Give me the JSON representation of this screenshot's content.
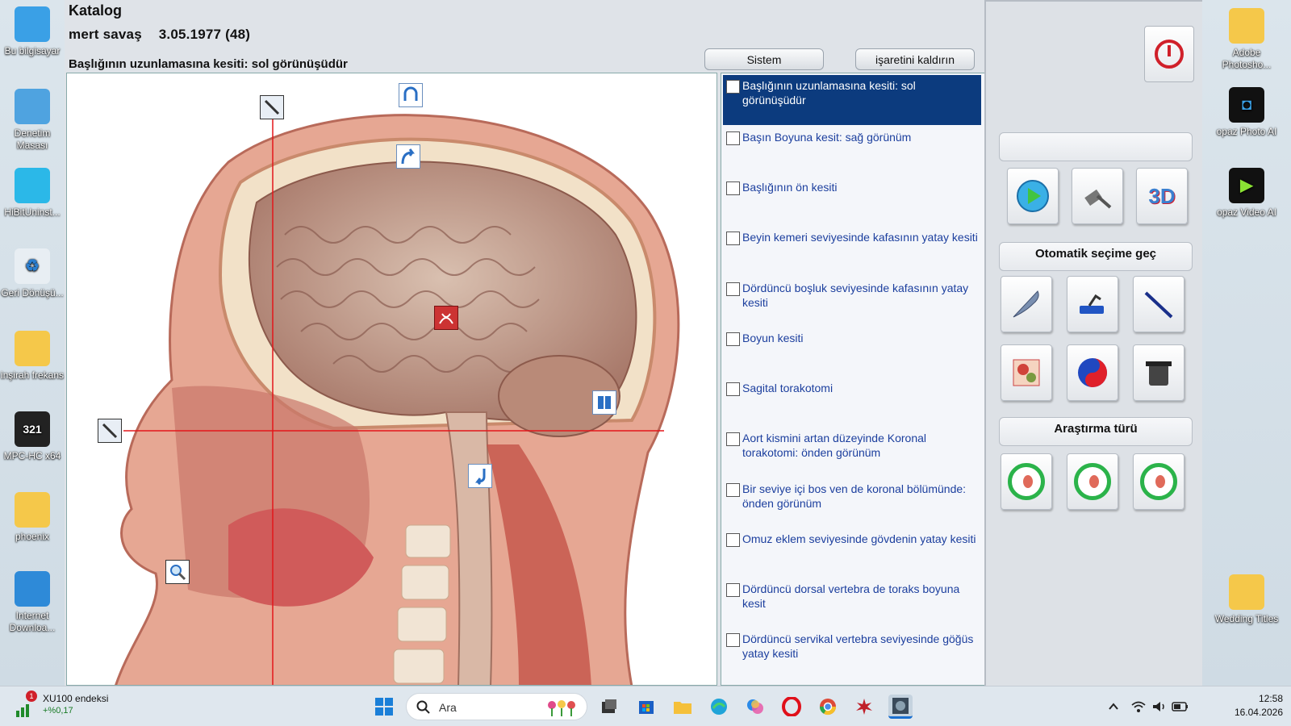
{
  "desktop_left": [
    {
      "label": "Bu bilgisayar"
    },
    {
      "label": "Denetim Masası"
    },
    {
      "label": "HiBitUninst..."
    },
    {
      "label": "Geri Dönüşü..."
    },
    {
      "label": "inşirah frekans"
    },
    {
      "label": "MPC-HC x64"
    },
    {
      "label": "phoenix"
    },
    {
      "label": "Internet Downloa..."
    }
  ],
  "desktop_right": [
    {
      "label": "Adobe Photosho..."
    },
    {
      "label": "opaz Photo AI"
    },
    {
      "label": "opaz Video AI"
    },
    {
      "label": "Wedding Titles"
    }
  ],
  "app": {
    "title": "Katalog",
    "patient_name": "mert  savaş",
    "patient_dob": "3.05.1977 (48)",
    "view_title": "Başlığının uzunlamasına kesiti: sol görünüşüdür",
    "btn_sistem": "Sistem",
    "btn_unmark": "işaretini kaldırın"
  },
  "list": {
    "items": [
      {
        "label": "Başlığının uzunlamasına kesiti: sol görünüşüdür",
        "selected": true
      },
      {
        "label": "Başın Boyuna kesit: sağ görünüm",
        "selected": false
      },
      {
        "label": "Başlığının ön kesiti",
        "selected": false
      },
      {
        "label": "Beyin kemeri seviyesinde kafasının yatay kesiti",
        "selected": false
      },
      {
        "label": "Dördüncü boşluk seviyesinde kafasının yatay kesiti",
        "selected": false
      },
      {
        "label": "Boyun kesiti",
        "selected": false
      },
      {
        "label": "Sagital torakotomi",
        "selected": false
      },
      {
        "label": "Aort kismini artan düzeyinde Koronal torakotomi: önden görünüm",
        "selected": false
      },
      {
        "label": "Bir seviye içi bos ven de koronal bölümünde: önden görünüm",
        "selected": false
      },
      {
        "label": "Omuz eklem seviyesinde gövdenin yatay kesiti",
        "selected": false
      },
      {
        "label": "Dördüncü dorsal vertebra de toraks boyuna kesit",
        "selected": false
      },
      {
        "label": "Dördüncü servikal vertebra seviyesinde göğüs yatay kesiti",
        "selected": false
      }
    ]
  },
  "panel": {
    "auto_select_label": "Otomatik seçime geç",
    "research_type_label": "Araştırma türü"
  },
  "taskbar": {
    "news_title": "XU100 endeksi",
    "news_value": "+%0,17",
    "news_badge": "1",
    "search_label": "Ara",
    "time": "12:58",
    "date": "16.04.2026"
  }
}
